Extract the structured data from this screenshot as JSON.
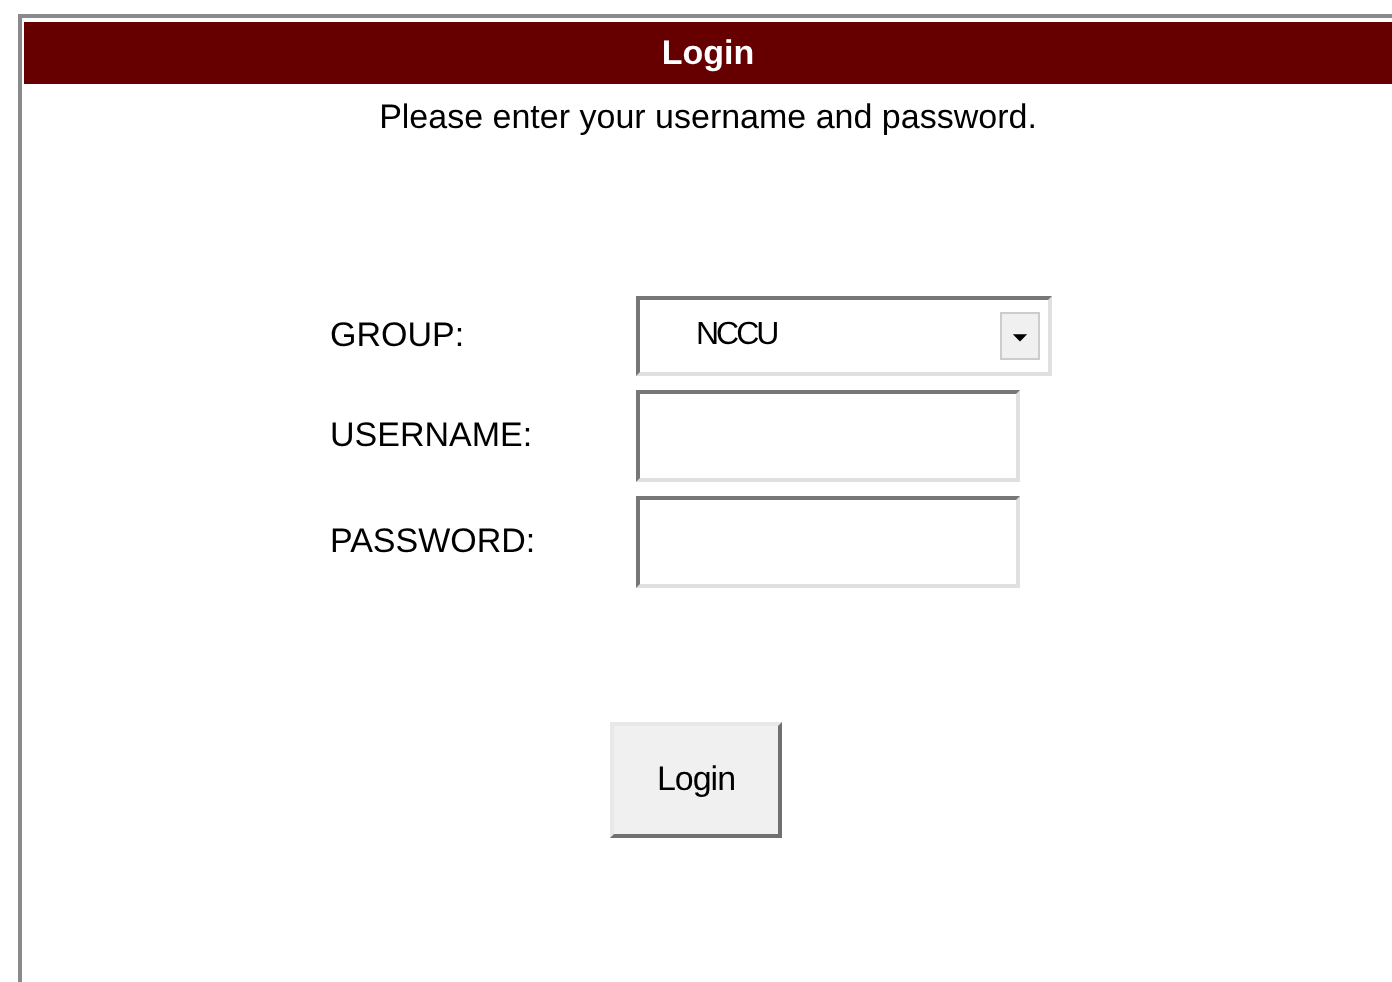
{
  "header": {
    "title": "Login"
  },
  "instruction": "Please enter your username and password.",
  "fields": [
    {
      "kind": "select",
      "label": "GROUP:",
      "value": "NCCU"
    },
    {
      "kind": "text",
      "label": "USERNAME:"
    },
    {
      "kind": "password",
      "label": "PASSWORD:"
    }
  ],
  "button": "Login"
}
